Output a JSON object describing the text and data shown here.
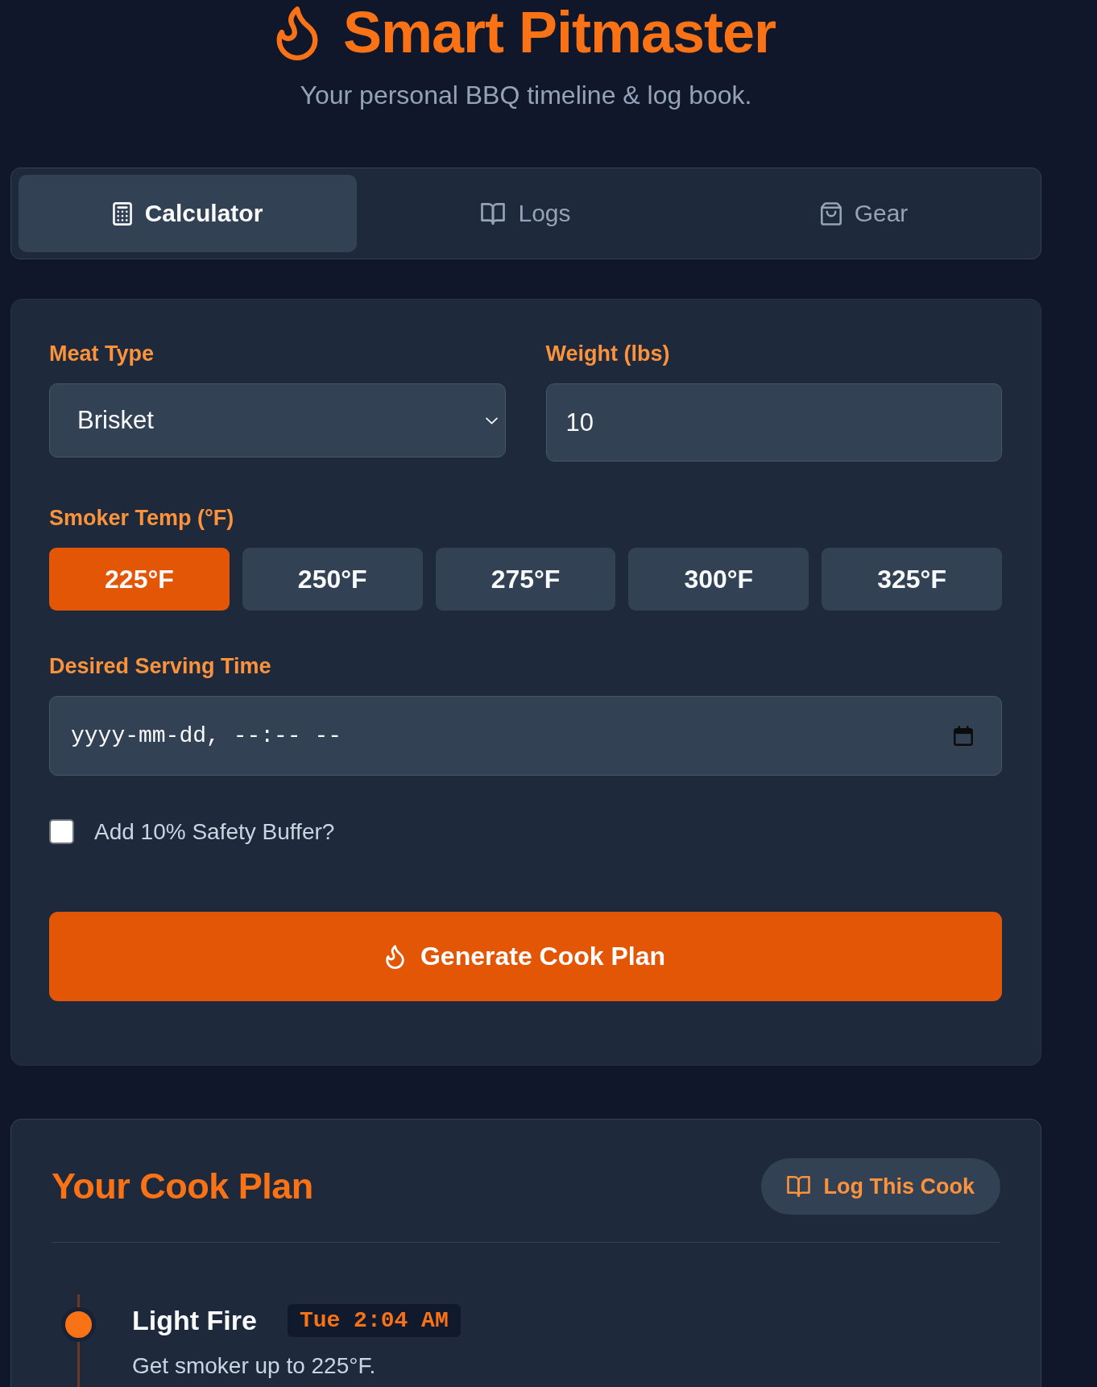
{
  "header": {
    "title": "Smart Pitmaster",
    "subtitle": "Your personal BBQ timeline & log book."
  },
  "tabs": [
    {
      "label": "Calculator",
      "selected": true
    },
    {
      "label": "Logs",
      "selected": false
    },
    {
      "label": "Gear",
      "selected": false
    }
  ],
  "calculator": {
    "meat_type": {
      "label": "Meat Type",
      "value": "Brisket"
    },
    "weight": {
      "label": "Weight (lbs)",
      "value": "10"
    },
    "smoker_temp": {
      "label": "Smoker Temp (°F)",
      "options": [
        {
          "label": "225°F",
          "selected": true
        },
        {
          "label": "250°F",
          "selected": false
        },
        {
          "label": "275°F",
          "selected": false
        },
        {
          "label": "300°F",
          "selected": false
        },
        {
          "label": "325°F",
          "selected": false
        }
      ]
    },
    "serving_time": {
      "label": "Desired Serving Time",
      "placeholder": "yyyy-mm-dd, --:-- --"
    },
    "safety_buffer": {
      "label": "Add 10% Safety Buffer?",
      "checked": false
    },
    "generate_button": {
      "label": "Generate Cook Plan"
    }
  },
  "cook_plan": {
    "title": "Your Cook Plan",
    "log_button": {
      "label": "Log This Cook"
    },
    "steps": [
      {
        "title": "Light Fire",
        "time": "Tue 2:04 AM",
        "description": "Get smoker up to 225°F."
      }
    ]
  }
}
